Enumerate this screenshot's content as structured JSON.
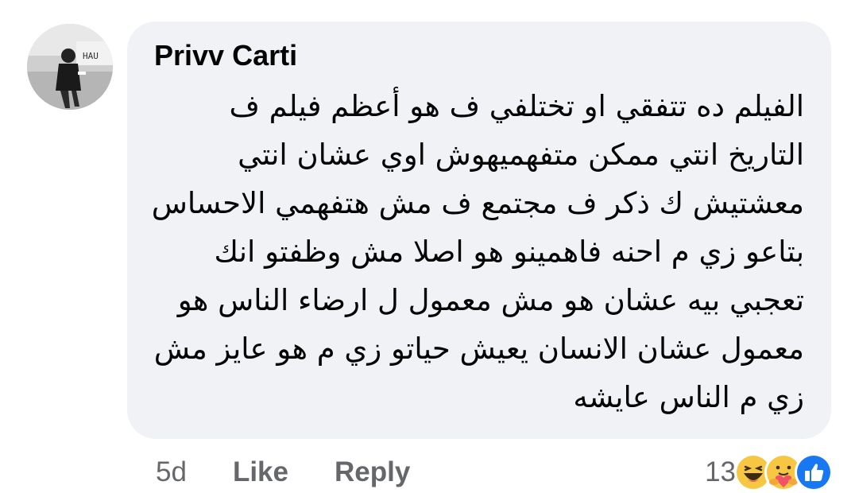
{
  "comment": {
    "author": "Privv Carti",
    "lines": [
      "الفيلم ده تتفقي او تختلفي ف هو أعظم فيلم ف",
      "التاريخ انتي ممكن متفهميهوش اوي عشان انتي",
      "معشتيش ك ذكر ف مجتمع ف مش هتفهمي الاحساس",
      "بتاعو زي م احنه فاهمينو هو اصلا مش وظفتو انك",
      "تعجبي بيه عشان هو مش معمول ل ارضاء الناس هو",
      "معمول عشان الانسان يعيش حياتو زي م هو عايز مش",
      "زي م الناس عايشه"
    ]
  },
  "actions": {
    "time": "5d",
    "like_label": "Like",
    "reply_label": "Reply"
  },
  "reactions": {
    "count": "13",
    "icons": [
      "haha-icon",
      "care-icon",
      "like-icon"
    ]
  },
  "colors": {
    "bubble": "#f0f2f5",
    "text": "#050505",
    "meta": "#65676b",
    "like_blue": "#1877f2",
    "emoji_yellow": "#f7c744"
  }
}
